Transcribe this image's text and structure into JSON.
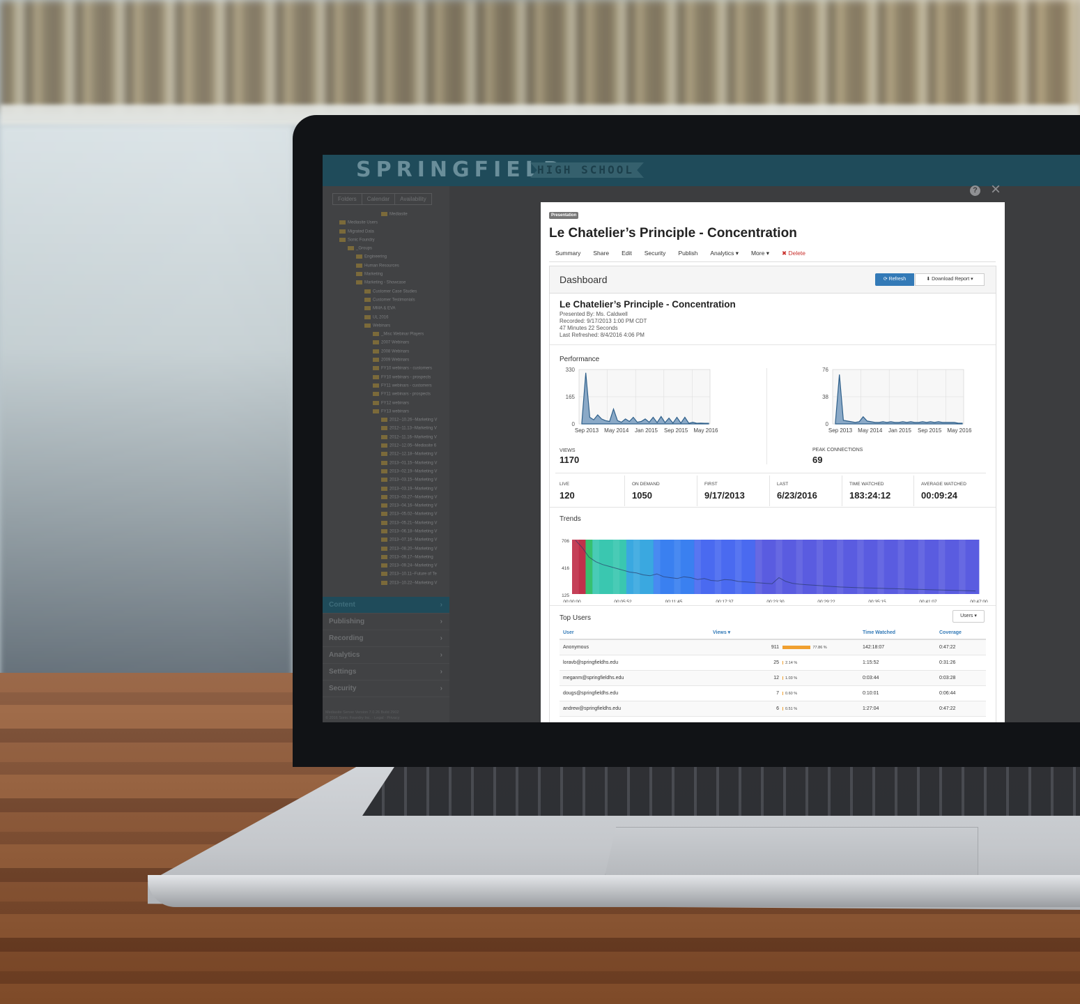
{
  "brand": {
    "main": "SPRINGFIELD",
    "sub": "HIGH SCHOOL"
  },
  "left_tabs": [
    "Folders",
    "Calendar",
    "Availability"
  ],
  "tree": [
    "Mediasite",
    "Mediasite Users",
    "Migrated Data",
    "Sonic Foundry",
    "_Groups",
    "Engineering",
    "Human Resources",
    "Marketing",
    "Marketing - Showcase",
    "Customer Case Studies",
    "Customer Testimonials",
    "MMA & EVA",
    "UL 2016",
    "Webinars",
    "_Misc Webinar Players",
    "2007 Webinars",
    "2008 Webinars",
    "2009 Webinars",
    "FY10 webinars - customers",
    "FY10 webinars - prospects",
    "FY11 webinars - customers",
    "FY11 webinars - prospects",
    "FY12 webinars",
    "FY13 webinars",
    "2012--10.26--Marketing V",
    "2012--11.13--Marketing V",
    "2012--11.16--Marketing V",
    "2012--12.05--Mediasite 6",
    "2012--12.18--Marketing V",
    "2013--01.15--Marketing V",
    "2013--02.19--Marketing V",
    "2013--03.15--Marketing V",
    "2013--03.19--Marketing V",
    "2013--03.27--Marketing V",
    "2013--04.16--Marketing V",
    "2013--05.02--Marketing V",
    "2013--05.21--Marketing V",
    "2013--06.18--Marketing V",
    "2013--07.16--Marketing V",
    "2013--08.20--Marketing V",
    "2013--09.17--Marketing",
    "2013--09.24--Marketing V",
    "2013--10.11--Future of Te",
    "2013--10.22--Marketing V"
  ],
  "left_nav": [
    {
      "label": "Content",
      "active": true
    },
    {
      "label": "Publishing",
      "active": false
    },
    {
      "label": "Recording",
      "active": false
    },
    {
      "label": "Analytics",
      "active": false
    },
    {
      "label": "Settings",
      "active": false
    },
    {
      "label": "Security",
      "active": false
    }
  ],
  "version": {
    "line1": "Mediasite Server Version 7.0.26 Build 2902",
    "line2": "© 2016 Sonic Foundry Inc. · Legal · Privacy"
  },
  "modal": {
    "badge": "Presentation",
    "title": "Le Chatelier’s Principle - Concentration",
    "menu": [
      {
        "label": "Summary"
      },
      {
        "label": "Share"
      },
      {
        "label": "Edit"
      },
      {
        "label": "Security"
      },
      {
        "label": "Publish"
      },
      {
        "label": "Analytics ▾"
      },
      {
        "label": "More ▾"
      }
    ],
    "delete_label": "✖ Delete"
  },
  "dashboard": {
    "title": "Dashboard",
    "refresh_label": "⟳ Refresh",
    "download_label": "⬇ Download Report ▾",
    "pres_title": "Le Chatelier’s Principle - Concentration",
    "presented_by": "Presented By: Ms. Caldwell",
    "recorded": "Recorded: 9/17/2013 1:00 PM CDT",
    "duration": "47 Minutes 22 Seconds",
    "last_refreshed": "Last Refreshed: 8/4/2016 4:06 PM",
    "performance_label": "Performance",
    "views_label": "VIEWS",
    "views_value": "1170",
    "peak_label": "PEAK CONNECTIONS",
    "peak_value": "69",
    "stats": [
      {
        "label": "LIVE",
        "value": "120"
      },
      {
        "label": "ON DEMAND",
        "value": "1050"
      },
      {
        "label": "FIRST",
        "value": "9/17/2013"
      },
      {
        "label": "LAST",
        "value": "6/23/2016"
      },
      {
        "label": "TIME WATCHED",
        "value": "183:24:12"
      },
      {
        "label": "AVERAGE WATCHED",
        "value": "00:09:24"
      }
    ],
    "trends_label": "Trends",
    "top_users_label": "Top Users",
    "users_button": "Users ▾",
    "table_headers": {
      "user": "User",
      "views": "Views ▾",
      "time": "Time Watched",
      "coverage": "Coverage"
    },
    "users": [
      {
        "user": "Anonymous",
        "views": "911",
        "pct_text": "77.86 %",
        "pct": 77.86,
        "time": "142:18:07",
        "coverage": "0:47:22"
      },
      {
        "user": "loravb@springfieldhs.edu",
        "views": "25",
        "pct_text": "2.14 %",
        "pct": 2.14,
        "time": "1:15:52",
        "coverage": "0:31:26"
      },
      {
        "user": "meganm@springfieldhs.edu",
        "views": "12",
        "pct_text": "1.03 %",
        "pct": 1.03,
        "time": "0:03:44",
        "coverage": "0:03:28"
      },
      {
        "user": "dougs@springfieldhs.edu",
        "views": "7",
        "pct_text": "0.60 %",
        "pct": 0.6,
        "time": "0:10:01",
        "coverage": "0:06:44"
      },
      {
        "user": "andrew@springfieldhs.edu",
        "views": "6",
        "pct_text": "0.51 %",
        "pct": 0.51,
        "time": "1:27:04",
        "coverage": "0:47:22"
      }
    ]
  },
  "chart_data": [
    {
      "type": "area",
      "ylim": [
        0,
        330
      ],
      "yticks": [
        "330",
        "165",
        "0"
      ],
      "xticks": [
        "Sep 2013",
        "May 2014",
        "Jan 2015",
        "Sep 2015",
        "May 2016"
      ],
      "values": [
        5,
        310,
        40,
        25,
        55,
        30,
        20,
        15,
        90,
        20,
        10,
        30,
        15,
        40,
        10,
        15,
        30,
        10,
        40,
        8,
        45,
        8,
        35,
        5,
        40,
        5,
        40,
        4,
        10,
        4,
        5,
        4,
        4
      ]
    },
    {
      "type": "area",
      "ylim": [
        0,
        76
      ],
      "yticks": [
        "76",
        "38",
        "0"
      ],
      "xticks": [
        "Sep 2013",
        "May 2014",
        "Jan 2015",
        "Sep 2015",
        "May 2016"
      ],
      "values": [
        2,
        69,
        5,
        4,
        3,
        2,
        3,
        10,
        4,
        3,
        2,
        2,
        3,
        2,
        3,
        2,
        2,
        3,
        2,
        3,
        2,
        2,
        3,
        2,
        3,
        2,
        3,
        2,
        2,
        2,
        2,
        1,
        1
      ]
    },
    {
      "type": "heatmap",
      "ylim": [
        125,
        706
      ],
      "yticks": [
        "706",
        "416",
        "125"
      ],
      "xticks": [
        "00:00:00",
        "00:05:52",
        "00:11:45",
        "00:17:37",
        "00:23:30",
        "00:29:22",
        "00:35:15",
        "00:41:07",
        "00:47:00"
      ],
      "values": [
        700,
        620,
        520,
        470,
        440,
        420,
        400,
        380,
        360,
        350,
        330,
        320,
        340,
        310,
        300,
        290,
        310,
        300,
        280,
        290,
        270,
        265,
        280,
        275,
        260,
        255,
        250,
        245,
        240,
        235,
        300,
        260,
        240,
        230,
        225,
        220,
        215,
        210,
        205,
        200,
        198,
        195,
        192,
        190,
        188,
        186,
        184,
        182,
        180,
        178,
        176,
        174,
        172,
        170,
        168,
        166,
        164,
        162,
        160,
        158
      ]
    }
  ],
  "colors": {
    "accent": "#337ab7",
    "header": "#1f4b5a",
    "delete": "#c9302c",
    "bar": "#f0a030",
    "chart_line": "#2e5f8a",
    "chart_fill": "#8aa9c7"
  }
}
